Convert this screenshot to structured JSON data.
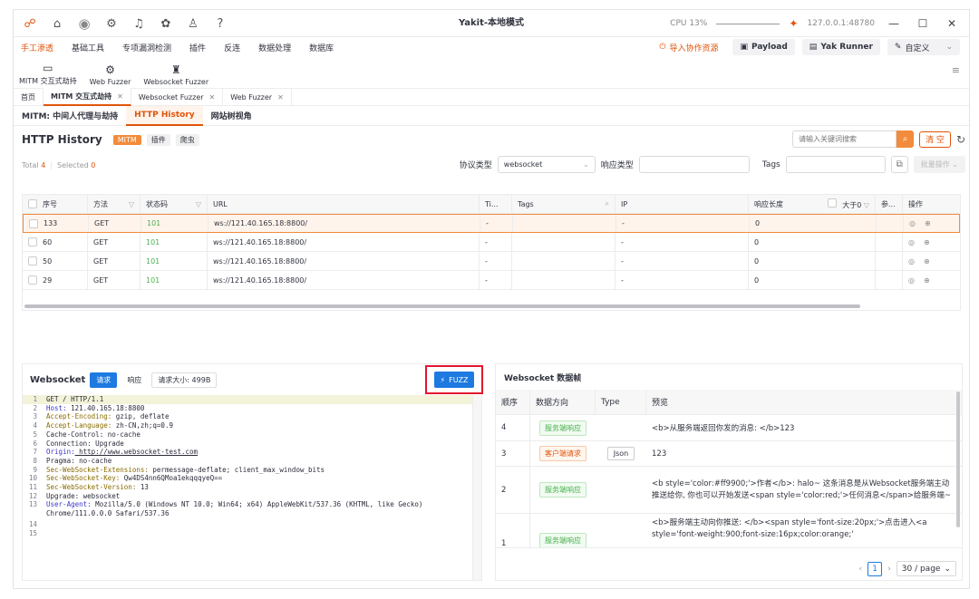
{
  "titlebar": {
    "title": "Yakit-本地模式",
    "cpu": "CPU 13%",
    "engine": "127.0.0.1:48780"
  },
  "menu": {
    "items": [
      "手工渗透",
      "基础工具",
      "专项漏洞检测",
      "插件",
      "反连",
      "数据处理",
      "数据库"
    ],
    "import": "导入协作资源",
    "payload": "Payload",
    "yak_runner": "Yak Runner",
    "custom": "自定义"
  },
  "tools": [
    {
      "label": "MITM 交互式劫持",
      "icon": "mitm-icon"
    },
    {
      "label": "Web Fuzzer",
      "icon": "fuzzer-icon"
    },
    {
      "label": "Websocket Fuzzer",
      "icon": "ws-fuzzer-icon"
    }
  ],
  "tabs1": [
    {
      "label": "首页"
    },
    {
      "label": "MITM 交互式劫持"
    },
    {
      "label": "Websocket Fuzzer"
    },
    {
      "label": "Web Fuzzer"
    }
  ],
  "tabs2": [
    "MITM: 中间人代理与劫持",
    "HTTP History",
    "网站树视角"
  ],
  "history": {
    "title": "HTTP History",
    "chips": [
      "MITM",
      "插件",
      "爬虫"
    ],
    "search_placeholder": "请输入关键词搜索",
    "clear": "清 空",
    "total_label": "Total",
    "total": "4",
    "selected_label": "Selected",
    "selected": "0",
    "proto_label": "协议类型",
    "proto_value": "websocket",
    "resp_label": "响应类型",
    "tags_label": "Tags",
    "batch": "批量操作"
  },
  "table": {
    "headers": [
      "序号",
      "方法",
      "状态码",
      "URL",
      "Ti...",
      "Tags",
      "IP",
      "响应长度",
      "大于0",
      "参...",
      "操作"
    ],
    "rows": [
      {
        "id": "133",
        "method": "GET",
        "status": "101",
        "url": "ws://121.40.165.18:8800/",
        "ti": "-",
        "ip": "-",
        "len": "0"
      },
      {
        "id": "60",
        "method": "GET",
        "status": "101",
        "url": "ws://121.40.165.18:8800/",
        "ti": "-",
        "ip": "-",
        "len": "0"
      },
      {
        "id": "50",
        "method": "GET",
        "status": "101",
        "url": "ws://121.40.165.18:8800/",
        "ti": "-",
        "ip": "-",
        "len": "0"
      },
      {
        "id": "29",
        "method": "GET",
        "status": "101",
        "url": "ws://121.40.165.18:8800/",
        "ti": "-",
        "ip": "-",
        "len": "0"
      }
    ]
  },
  "ws": {
    "title": "Websocket",
    "req": "请求",
    "resp": "响应",
    "size": "请求大小: 499B",
    "fuzz": "FUZZ",
    "lines": [
      {
        "n": "1",
        "k": "",
        "v": "GET / HTTP/1.1"
      },
      {
        "n": "2",
        "k": "Host:",
        "v": " 121.40.165.18:8800"
      },
      {
        "n": "3",
        "k": "Accept-Encoding:",
        "v": " gzip, deflate"
      },
      {
        "n": "4",
        "k": "Accept-Language:",
        "v": " zh-CN,zh;q=0.9"
      },
      {
        "n": "5",
        "k": "",
        "v": "Cache-Control: no-cache"
      },
      {
        "n": "6",
        "k": "",
        "v": "Connection: Upgrade"
      },
      {
        "n": "7",
        "k": "Origin:",
        "v": " http://www.websocket-test.com"
      },
      {
        "n": "8",
        "k": "",
        "v": "Pragma: no-cache"
      },
      {
        "n": "9",
        "k": "Sec-WebSocket-Extensions:",
        "v": " permessage-deflate; client_max_window_bits"
      },
      {
        "n": "10",
        "k": "Sec-WebSocket-Key:",
        "v": " Qw4DS4nn6QMoa1ekqqqyeQ=="
      },
      {
        "n": "11",
        "k": "Sec-WebSocket-Version:",
        "v": " 13"
      },
      {
        "n": "12",
        "k": "",
        "v": "Upgrade: websocket"
      },
      {
        "n": "13",
        "k": "User-Agent:",
        "v": " Mozilla/5.0 (Windows NT 10.0; Win64; x64) AppleWebKit/537.36 (KHTML, like Gecko)"
      },
      {
        "n": "",
        "k": "",
        "v": "Chrome/111.0.0.0 Safari/537.36"
      },
      {
        "n": "14",
        "k": "",
        "v": ""
      },
      {
        "n": "15",
        "k": "",
        "v": ""
      }
    ]
  },
  "frames": {
    "title": "Websocket 数据帧",
    "headers": [
      "顺序",
      "数据方向",
      "Type",
      "预览"
    ],
    "rows": [
      {
        "n": "4",
        "dir": "服务端响应",
        "kind": "g",
        "type": "",
        "preview": "<b>从服务端返回你发的消息: </b>123"
      },
      {
        "n": "3",
        "dir": "客户端请求",
        "kind": "o",
        "type": "Json",
        "preview": "123"
      },
      {
        "n": "2",
        "dir": "服务端响应",
        "kind": "g",
        "type": "",
        "preview": "<b style='color:#ff9900;'>作者</b>: halo~ 这条消息是从Websocket服务端主动推送给你, 你也可以开始发送<span style='color:red;'>任何消息</span>给服务端~"
      },
      {
        "n": "1",
        "dir": "服务端响应",
        "kind": "g",
        "type": "",
        "preview": "<b>服务端主动向你推送: </b><span style='font-size:20px;'>点击进入<a style='font-weight:900;font-size:16px;color:orange;'"
      }
    ],
    "page": "1",
    "page_size": "30 / page"
  }
}
